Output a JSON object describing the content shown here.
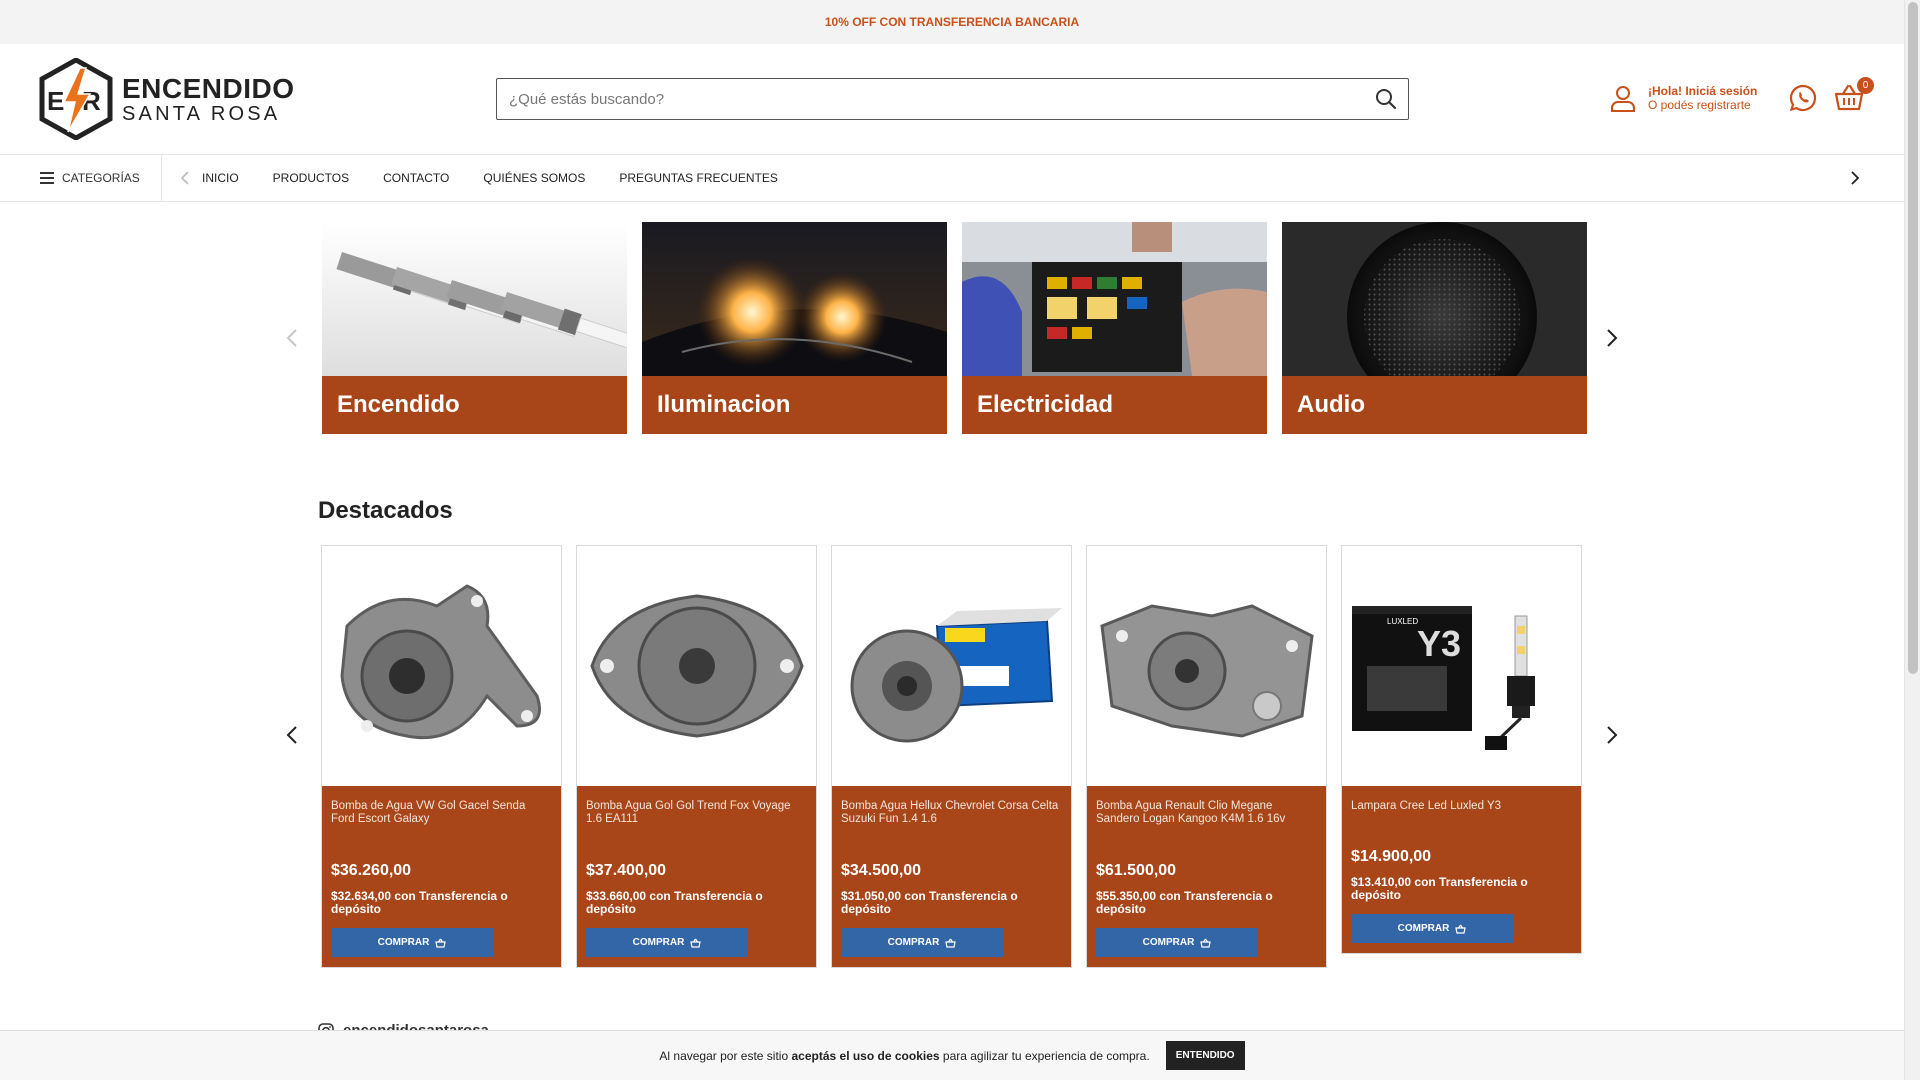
{
  "announcement": "10% OFF CON TRANSFERENCIA BANCARIA",
  "brand": {
    "line1": "ENCENDIDO",
    "line2": "SANTA ROSA",
    "logo_icon": "bolt-er-logo"
  },
  "search": {
    "placeholder": "¿Qué estás buscando?"
  },
  "account": {
    "greeting": "¡Hola! Iniciá sesión",
    "subtext": "O podés registrarte"
  },
  "cart": {
    "count": "0"
  },
  "nav": {
    "categories_label": "CATEGORÍAS",
    "items": [
      "INICIO",
      "PRODUCTOS",
      "CONTACTO",
      "QUIÉNES SOMOS",
      "PREGUNTAS FRECUENTES"
    ]
  },
  "categories": [
    {
      "label": "Encendido",
      "image": "spark-plugs"
    },
    {
      "label": "Iluminacion",
      "image": "headlights"
    },
    {
      "label": "Electricidad",
      "image": "fuse-box"
    },
    {
      "label": "Audio",
      "image": "speaker"
    }
  ],
  "featured": {
    "title": "Destacados",
    "products": [
      {
        "name": "Bomba de Agua VW Gol Gacel Senda Ford Escort Galaxy",
        "price": "$36.260,00",
        "transfer": "$32.634,00 con Transferencia o depósito",
        "buy": "COMPRAR"
      },
      {
        "name": "Bomba Agua Gol Gol Trend Fox Voyage 1.6 EA111",
        "price": "$37.400,00",
        "transfer": "$33.660,00 con Transferencia o depósito",
        "buy": "COMPRAR"
      },
      {
        "name": "Bomba Agua Hellux Chevrolet Corsa Celta Suzuki Fun 1.4 1.6",
        "price": "$34.500,00",
        "transfer": "$31.050,00 con Transferencia o depósito",
        "buy": "COMPRAR"
      },
      {
        "name": "Bomba Agua Renault Clio Megane Sandero Logan Kangoo K4M 1.6 16v",
        "price": "$61.500,00",
        "transfer": "$55.350,00 con Transferencia o depósito",
        "buy": "COMPRAR"
      },
      {
        "name": "Lampara Cree Led Luxled Y3",
        "price": "$14.900,00",
        "transfer": "$13.410,00 con Transferencia o depósito",
        "buy": "COMPRAR"
      }
    ]
  },
  "instagram": {
    "handle": "encendidosantarosa"
  },
  "cookie": {
    "before": "Al navegar por este sitio ",
    "bold": "aceptás el uso de cookies",
    "after": " para agilizar tu experiencia de compra.",
    "button": "ENTENDIDO"
  },
  "colors": {
    "accent": "#c8501a",
    "card": "#a8461a",
    "button": "#3366a7"
  }
}
